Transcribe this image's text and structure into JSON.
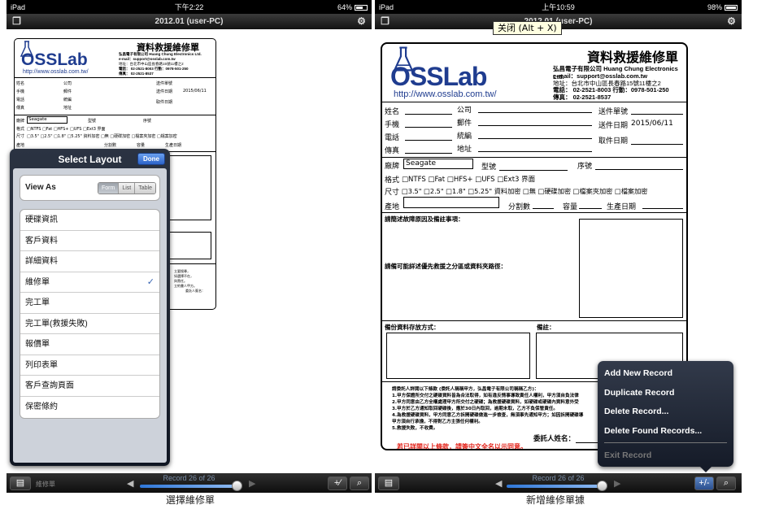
{
  "left_screen": {
    "status": {
      "carrier": "iPad",
      "time": "下午2:22",
      "battery": "64%"
    },
    "title": "2012.01 (user-PC)",
    "form": {
      "company_cn": "弘昌電子有限公司 Huang Chung Electronics Ltd.",
      "title": "資料救援維修單",
      "logo": "OSSLab",
      "url": "http://www.osslab.com.tw/",
      "email": "e-mail：support@osslab.com.tw",
      "address": "地址：台北市中山區長春路15號11樓之2",
      "phone": "電話： 02-2521-8003  行動：0978-501-250",
      "fax": "傳真： 02-2521-8537",
      "labels": {
        "name": "姓名",
        "company": "公司",
        "delivery_no": "送件單號",
        "mobile": "手機",
        "email": "郵件",
        "delivery_date": "送件日期",
        "tel": "電話",
        "tax_id": "統編",
        "pickup_date": "取件日期",
        "fax": "傳真",
        "address": "地址",
        "brand": "廠牌",
        "model": "型號",
        "serial": "序號",
        "format": "格式",
        "size": "尺寸",
        "origin": "產地",
        "partitions": "分割數",
        "capacity": "容量",
        "manufacture_date": "生產日期"
      },
      "values": {
        "delivery_date": "2015/06/11",
        "brand": "Seagate"
      },
      "format_options": "□NTFS □Fat □HFS+ □UFS □Ext3  界面",
      "size_options": "□3.5\" □2.5\" □1.8\" □5.25\"  資料加密 □無 □硬碟加密 □檔案夾加密 □檔案加密",
      "notes_right": [
        "立要搜尋，",
        "如選擇不在，",
        "與責任。",
        "立約書人甲方。",
        "委託人簽名："
      ]
    },
    "popover": {
      "title": "Select Layout",
      "done": "Done",
      "view_as": "View As",
      "segments": [
        "Form",
        "List",
        "Table"
      ],
      "active_segment": "Form",
      "items": [
        "硬碟資訊",
        "客戶資料",
        "詳細資料",
        "維修單",
        "完工單",
        "完工單(救援失敗)",
        "報價單",
        "列印表單",
        "客戶查詢頁面",
        "保密條約"
      ],
      "checked": "維修單",
      "check_mark": "✓"
    },
    "toolbar": {
      "layout_name": "維修單",
      "record": "Record 26 of 26",
      "prev": "◀",
      "next": "▶",
      "progress": 1.0
    },
    "caption": "選擇維修單"
  },
  "right_screen": {
    "status": {
      "carrier": "iPad",
      "time": "上午10:59",
      "battery": "98%"
    },
    "title": "2012.01 (user-PC)",
    "tooltip": "关闭 (Alt + X)",
    "form": {
      "company_cn": "弘昌電子有限公司 Huang Chung Electronics Ltd.",
      "title": "資料救援維修單",
      "logo": "OSSLab",
      "url": "http://www.osslab.com.tw/",
      "email": "e-mail：support@osslab.com.tw",
      "address": "地址：台北市中山區長春路15號11樓之2",
      "phone": "電話： 02-2521-8003  行動：0978-501-250",
      "fax": "傳真： 02-2521-8537",
      "labels": {
        "name": "姓名",
        "company": "公司",
        "delivery_no": "送件單號",
        "mobile": "手機",
        "email": "郵件",
        "delivery_date": "送件日期",
        "tel": "電話",
        "tax_id": "統編",
        "pickup_date": "取件日期",
        "fax": "傳真",
        "address": "地址",
        "brand": "廠牌",
        "model": "型號",
        "serial": "序號",
        "format": "格式",
        "size": "尺寸",
        "origin": "產地",
        "partitions": "分割數",
        "capacity": "容量",
        "manufacture_date": "生產日期",
        "fault": "請簡述故障原因及備註事項：",
        "priority": "請備可能詳述優先救援之分區或資料夾路徑：",
        "backup": "備份資料存放方式：",
        "remark": "備註：",
        "client_sign": "委託人姓名："
      },
      "values": {
        "delivery_date": "2015/06/11",
        "brand": "Seagate"
      },
      "format_options": "□NTFS □Fat □HFS+ □UFS □Ext3  界面",
      "size_options": "□3.5\" □2.5\" □1.8\" □5.25\"  資料加密 □無 □硬碟加密 □檔案夾加密 □檔案加密",
      "terms": [
        "請委託人詳閱以下條款 (委託人稱稱甲方，弘昌電子有限公司稱稱乙方)：",
        "1.甲方保證所交付之硬碟資料皆為合法取得，如有違反情事導致責任人權利，甲方須自負法律",
        "2.甲方同意由乙方全權處理甲方所交付之硬碟；為救援硬碟資料，如硬碟或硬碟內資料意外受",
        "3.甲方於乙方通知取回硬碟後，應於30日內取回，逾期未取，乙方不負保管責任。",
        "4.為救援硬碟資料，甲方同意乙方拆開硬碟做進一步檢查，無須事先通知甲方；如因拆開硬碟導",
        "   甲方須自行承擔，不得對乙方主張任何權利。",
        "5.救援失敗，不收費。"
      ],
      "agree": "若已詳閱以上條款，請簽中文全名以示同意。"
    },
    "action_menu": {
      "items": [
        "Add New Record",
        "Duplicate Record",
        "Delete Record...",
        "Delete Found Records..."
      ],
      "disabled": "Exit Record"
    },
    "toolbar": {
      "record": "Record 26 of 26",
      "prev": "◀",
      "next": "▶",
      "progress": 1.0,
      "add_icon": "+/-"
    },
    "caption": "新增維修單據"
  }
}
